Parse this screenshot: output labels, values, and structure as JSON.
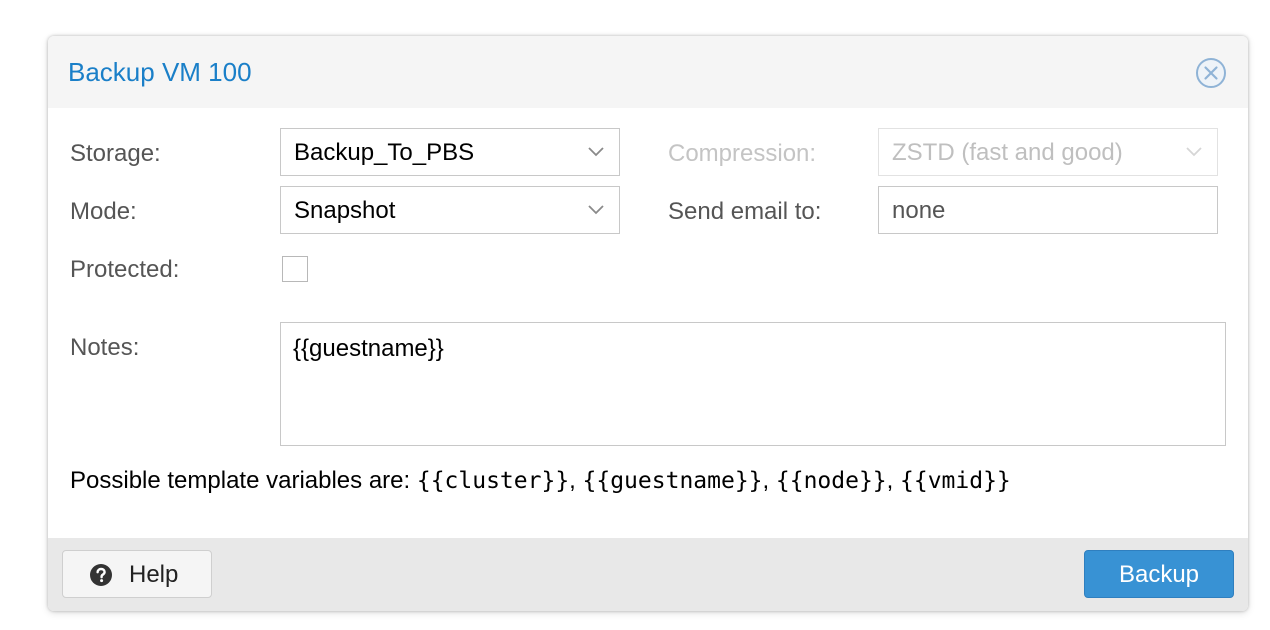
{
  "dialog": {
    "title": "Backup VM 100"
  },
  "form": {
    "storage_label": "Storage:",
    "storage_value": "Backup_To_PBS",
    "compression_label": "Compression:",
    "compression_value": "ZSTD (fast and good)",
    "mode_label": "Mode:",
    "mode_value": "Snapshot",
    "email_label": "Send email to:",
    "email_value": "none",
    "protected_label": "Protected:",
    "protected_checked": false,
    "notes_label": "Notes:",
    "notes_value": "{{guestname}}"
  },
  "template_help": {
    "prefix": "Possible template variables are: ",
    "variables": [
      "{{cluster}}",
      "{{guestname}}",
      "{{node}}",
      "{{vmid}}"
    ],
    "separator": ", "
  },
  "footer": {
    "help_label": "Help",
    "backup_label": "Backup"
  },
  "icons": {
    "close": "close-circle-icon",
    "help": "question-circle-icon",
    "dropdown": "chevron-down-icon"
  },
  "colors": {
    "title": "#1a7fc8",
    "primary_button": "#3892d4"
  }
}
